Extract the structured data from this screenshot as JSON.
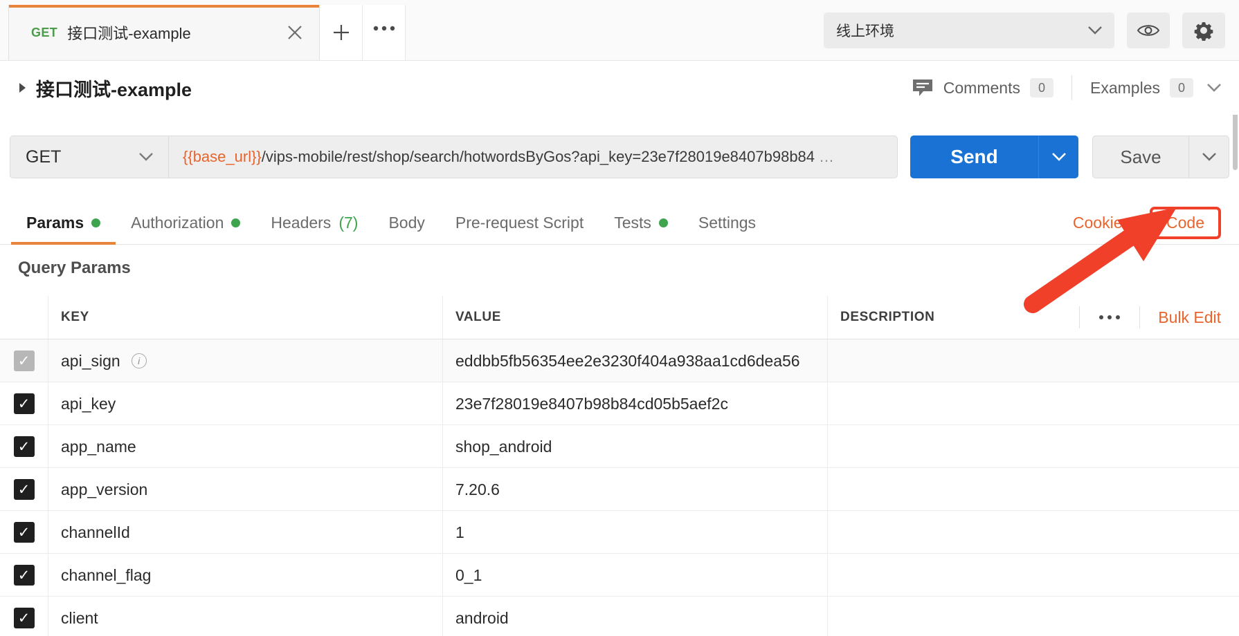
{
  "tab": {
    "method": "GET",
    "title": "接口测试-example",
    "close_icon": "close-icon",
    "new_tab_label": "+",
    "more_label": "•••"
  },
  "environment": {
    "selected": "线上环境",
    "caret": "▼",
    "eye_icon": "eye-icon",
    "settings_icon": "gear-icon"
  },
  "request_header": {
    "collapse_arrow": "▶",
    "name": "接口测试-example",
    "comments_label": "Comments",
    "comments_count": "0",
    "examples_label": "Examples",
    "examples_count": "0",
    "examples_caret": "▼"
  },
  "url_bar": {
    "method": "GET",
    "method_caret": "▼",
    "url_variable": "{{base_url}}",
    "url_path": "/vips-mobile/rest/shop/search/hotwordsByGos?api_key=23e7f28019e8407b98b84",
    "url_ellipsis": "…",
    "send_label": "Send",
    "send_caret": "▼",
    "save_label": "Save",
    "save_caret": "▼"
  },
  "section_tabs": [
    {
      "label": "Params",
      "dot": true,
      "active": true,
      "count": ""
    },
    {
      "label": "Authorization",
      "dot": true,
      "active": false,
      "count": ""
    },
    {
      "label": "Headers",
      "dot": false,
      "active": false,
      "count": "(7)"
    },
    {
      "label": "Body",
      "dot": false,
      "active": false,
      "count": ""
    },
    {
      "label": "Pre-request Script",
      "dot": false,
      "active": false,
      "count": ""
    },
    {
      "label": "Tests",
      "dot": true,
      "active": false,
      "count": ""
    },
    {
      "label": "Settings",
      "dot": false,
      "active": false,
      "count": ""
    }
  ],
  "section_actions": {
    "cookies_label": "Cookies",
    "code_label": "Code"
  },
  "query_params": {
    "title": "Query Params",
    "columns": [
      "KEY",
      "VALUE",
      "DESCRIPTION"
    ],
    "tools": {
      "more_label": "•••",
      "bulk_edit_label": "Bulk Edit"
    },
    "rows": [
      {
        "checked": true,
        "dim": true,
        "key": "api_sign",
        "info": true,
        "value": "eddbb5fb56354ee2e3230f404a938aa1cd6dea56",
        "description": ""
      },
      {
        "checked": true,
        "dim": false,
        "key": "api_key",
        "info": false,
        "value": "23e7f28019e8407b98b84cd05b5aef2c",
        "description": ""
      },
      {
        "checked": true,
        "dim": false,
        "key": "app_name",
        "info": false,
        "value": "shop_android",
        "description": ""
      },
      {
        "checked": true,
        "dim": false,
        "key": "app_version",
        "info": false,
        "value": "7.20.6",
        "description": ""
      },
      {
        "checked": true,
        "dim": false,
        "key": "channelId",
        "info": false,
        "value": "1",
        "description": ""
      },
      {
        "checked": true,
        "dim": false,
        "key": "channel_flag",
        "info": false,
        "value": "0_1",
        "description": ""
      },
      {
        "checked": true,
        "dim": false,
        "key": "client",
        "info": false,
        "value": "android",
        "description": ""
      }
    ]
  },
  "annotation": {
    "highlight_color": "#f0402a",
    "target": "Code"
  },
  "colors": {
    "accent_orange": "#e8642c",
    "tab_underline": "#e8833a",
    "send_blue": "#1a73d4",
    "method_green": "#4c9c4c",
    "dot_green": "#3ea44e",
    "annotation_red": "#f0402a"
  }
}
